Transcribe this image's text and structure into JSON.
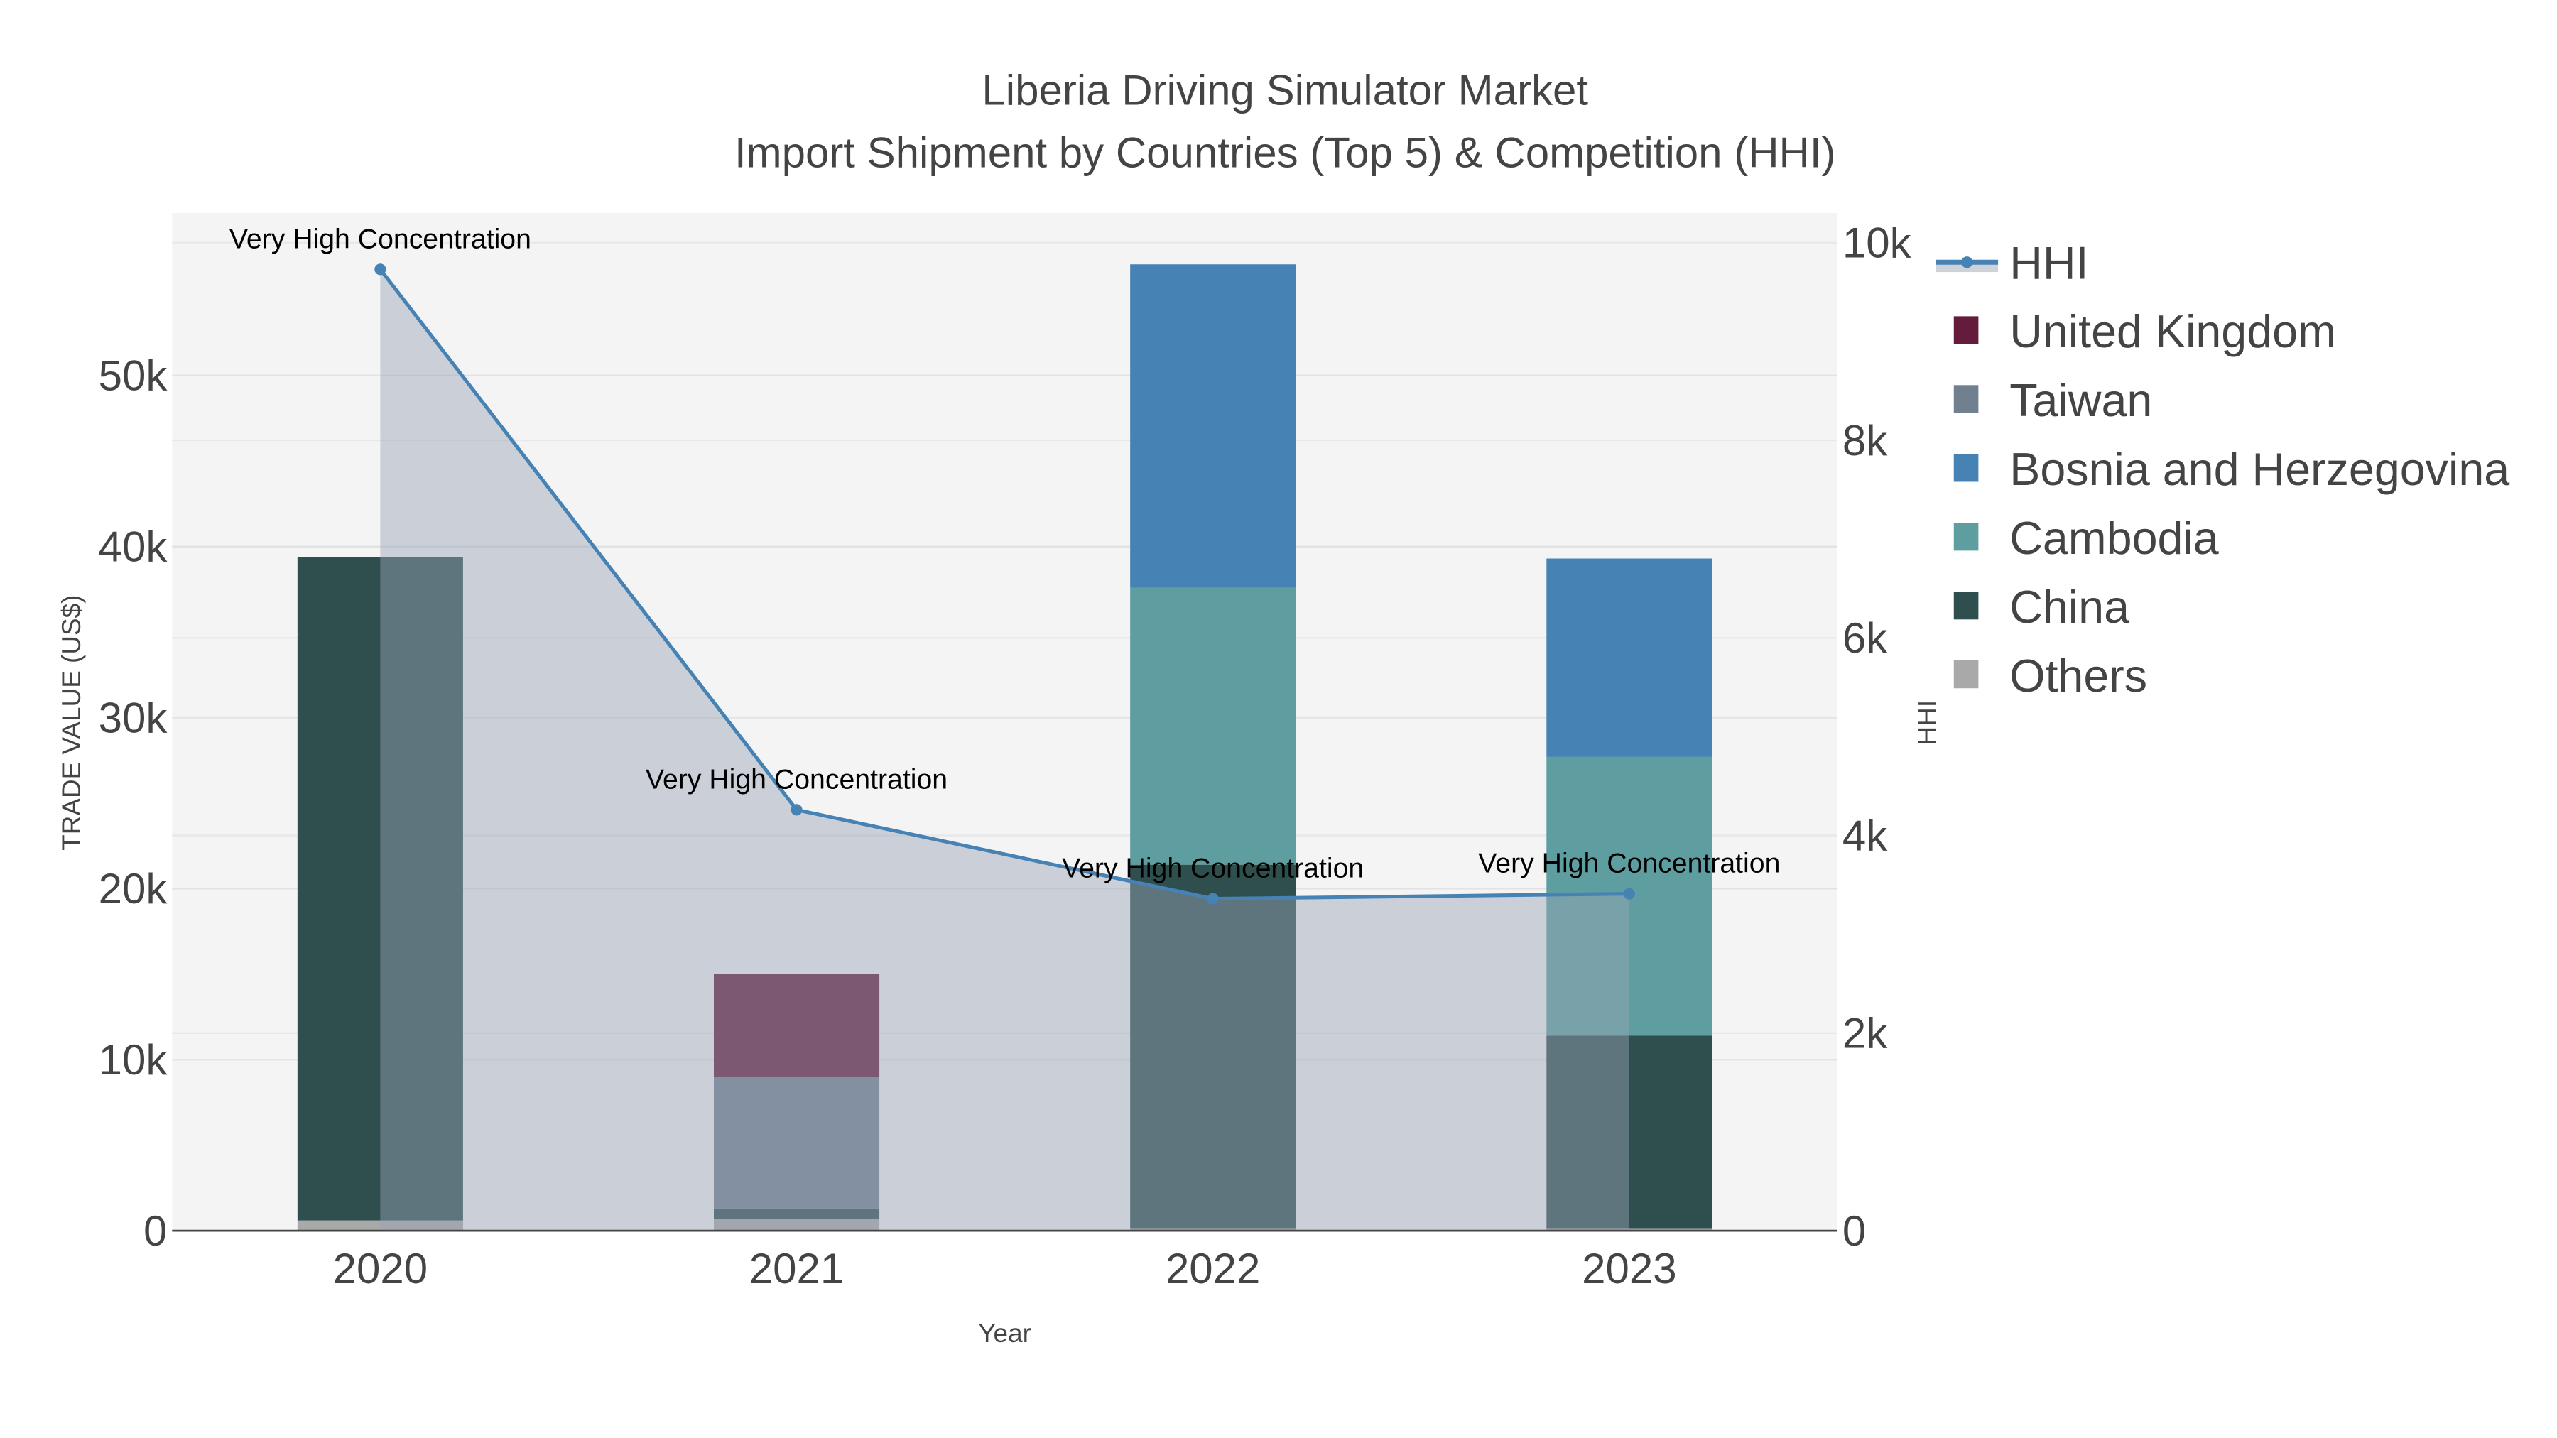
{
  "chart_data": {
    "type": "bar",
    "barmode": "stack",
    "title": "Liberia Driving Simulator Market",
    "subtitle": "Import Shipment by Countries (Top 5) & Competition (HHI)",
    "xlabel": "Year",
    "ylabel": "TRADE VALUE (US$)",
    "y2label": "HHI",
    "categories": [
      "2020",
      "2021",
      "2022",
      "2023"
    ],
    "ylim": [
      0,
      59500
    ],
    "y2lim": [
      0,
      10300
    ],
    "yticks": [
      0,
      10000,
      20000,
      30000,
      40000,
      50000
    ],
    "ytick_labels": [
      "0",
      "10k",
      "20k",
      "30k",
      "40k",
      "50k"
    ],
    "y2ticks": [
      0,
      2000,
      4000,
      6000,
      8000,
      10000
    ],
    "y2tick_labels": [
      "0",
      "2k",
      "4k",
      "6k",
      "8k",
      "10k"
    ],
    "series": [
      {
        "name": "Others",
        "color": "#a9a9a9",
        "values": [
          600,
          700,
          150,
          150
        ]
      },
      {
        "name": "China",
        "color": "#2f4f4f",
        "values": [
          38800,
          600,
          21250,
          11250
        ]
      },
      {
        "name": "Cambodia",
        "color": "#5f9ea0",
        "values": [
          0,
          0,
          16200,
          16300
        ]
      },
      {
        "name": "Bosnia and Herzegovina",
        "color": "#4682b4",
        "values": [
          0,
          0,
          18900,
          11600
        ]
      },
      {
        "name": "Taiwan",
        "color": "#708090",
        "values": [
          0,
          7700,
          0,
          0
        ]
      },
      {
        "name": "United Kingdom",
        "color": "#651b3b",
        "values": [
          0,
          6000,
          0,
          0
        ]
      }
    ],
    "hhi": {
      "name": "HHI",
      "color": "#4682b4",
      "fill": "#9aa5b6",
      "values": [
        9730,
        4260,
        3360,
        3410
      ],
      "annotations": [
        "Very High Concentration",
        "Very High Concentration",
        "Very High Concentration",
        "Very High Concentration"
      ]
    },
    "legend": {
      "placement": "right",
      "entries": [
        "HHI",
        "United Kingdom",
        "Taiwan",
        "Bosnia and Herzegovina",
        "Cambodia",
        "China",
        "Others"
      ]
    },
    "grid": true
  }
}
